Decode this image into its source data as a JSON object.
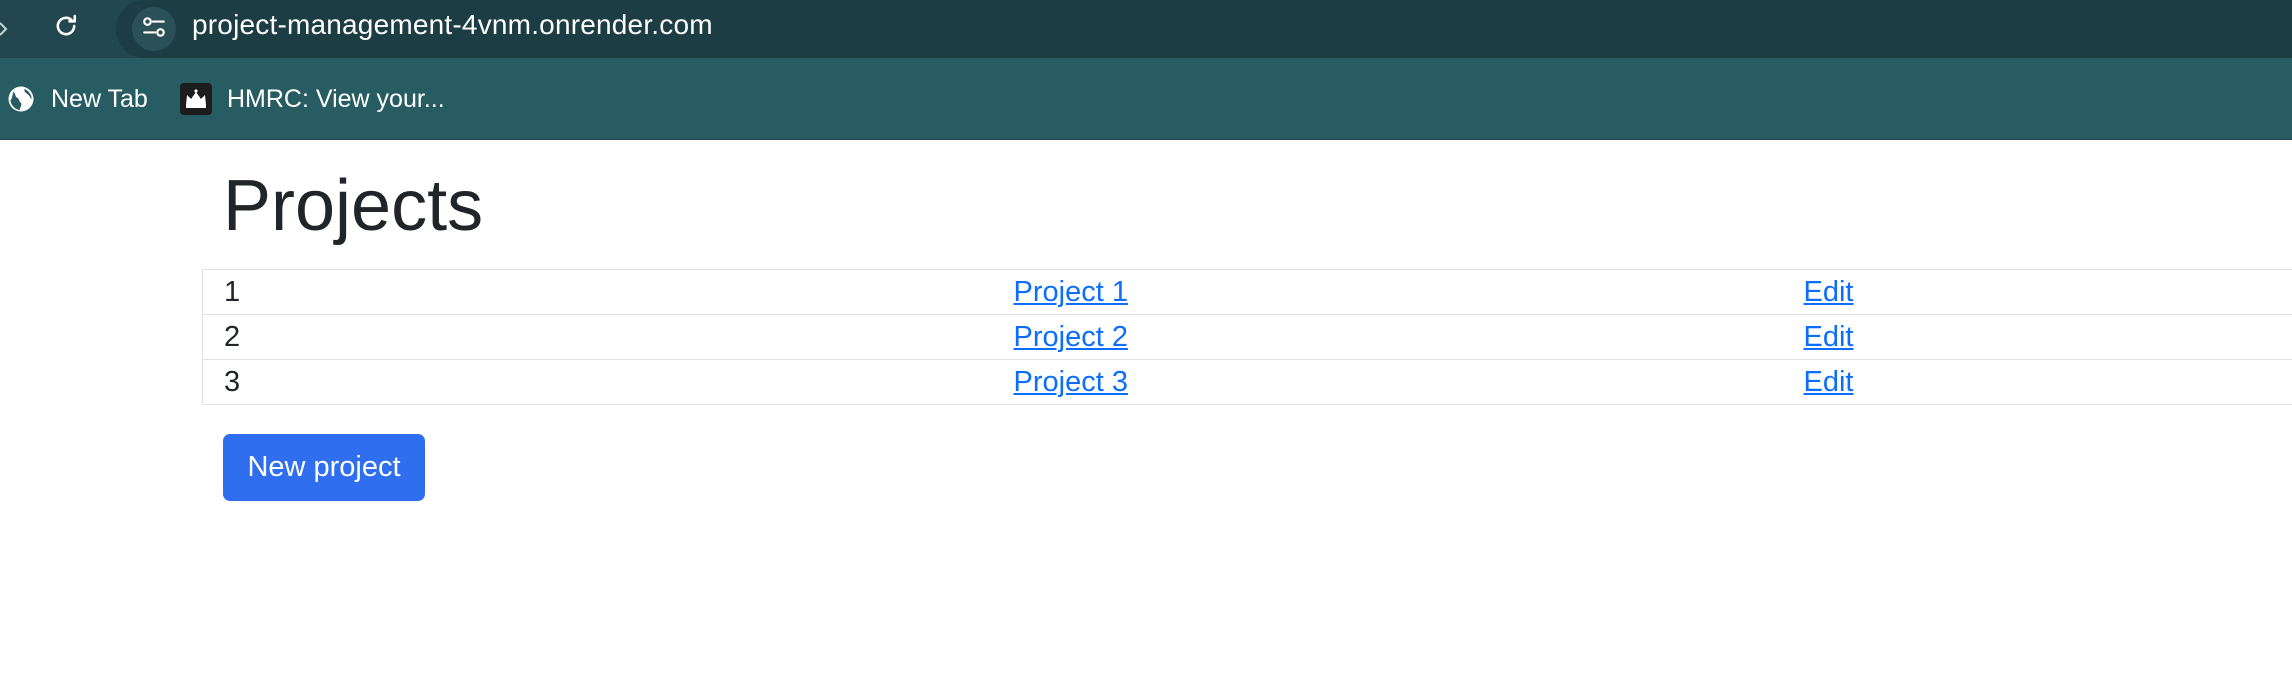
{
  "browser": {
    "url": "project-management-4vnm.onrender.com",
    "toolbar_color": "#22474f",
    "bookmarks": [
      {
        "label": "New Tab",
        "icon": "globe-icon"
      },
      {
        "label": "HMRC: View your...",
        "icon": "crown-icon"
      }
    ]
  },
  "page": {
    "title": "Projects",
    "projects": [
      {
        "id": "1",
        "name": "Project 1",
        "edit_label": "Edit"
      },
      {
        "id": "2",
        "name": "Project 2",
        "edit_label": "Edit"
      },
      {
        "id": "3",
        "name": "Project 3",
        "edit_label": "Edit"
      }
    ],
    "new_project_label": "New project",
    "link_color": "#0d6efd",
    "button_color": "#2f6fef"
  }
}
